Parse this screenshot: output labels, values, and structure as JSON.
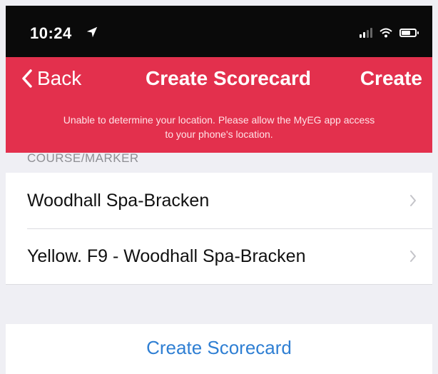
{
  "status_bar": {
    "time": "10:24"
  },
  "nav": {
    "back_label": "Back",
    "title": "Create Scorecard",
    "action_label": "Create"
  },
  "warning": {
    "line1": "Unable to determine your location. Please allow the MyEG app access",
    "line2": "to your phone's location."
  },
  "section": {
    "header": "COURSE/MARKER"
  },
  "rows": [
    {
      "label": "Woodhall Spa-Bracken"
    },
    {
      "label": "Yellow. F9 - Woodhall Spa-Bracken"
    }
  ],
  "footer": {
    "create_scorecard_label": "Create Scorecard"
  },
  "colors": {
    "accent_red": "#e3304d",
    "link_blue": "#2f7fd3",
    "grouped_bg": "#efeff4"
  },
  "icons": {
    "location": "location-arrow-icon",
    "signal": "cellular-signal-icon",
    "wifi": "wifi-icon",
    "battery": "battery-icon",
    "back": "chevron-left-icon",
    "disclosure": "chevron-right-icon"
  }
}
